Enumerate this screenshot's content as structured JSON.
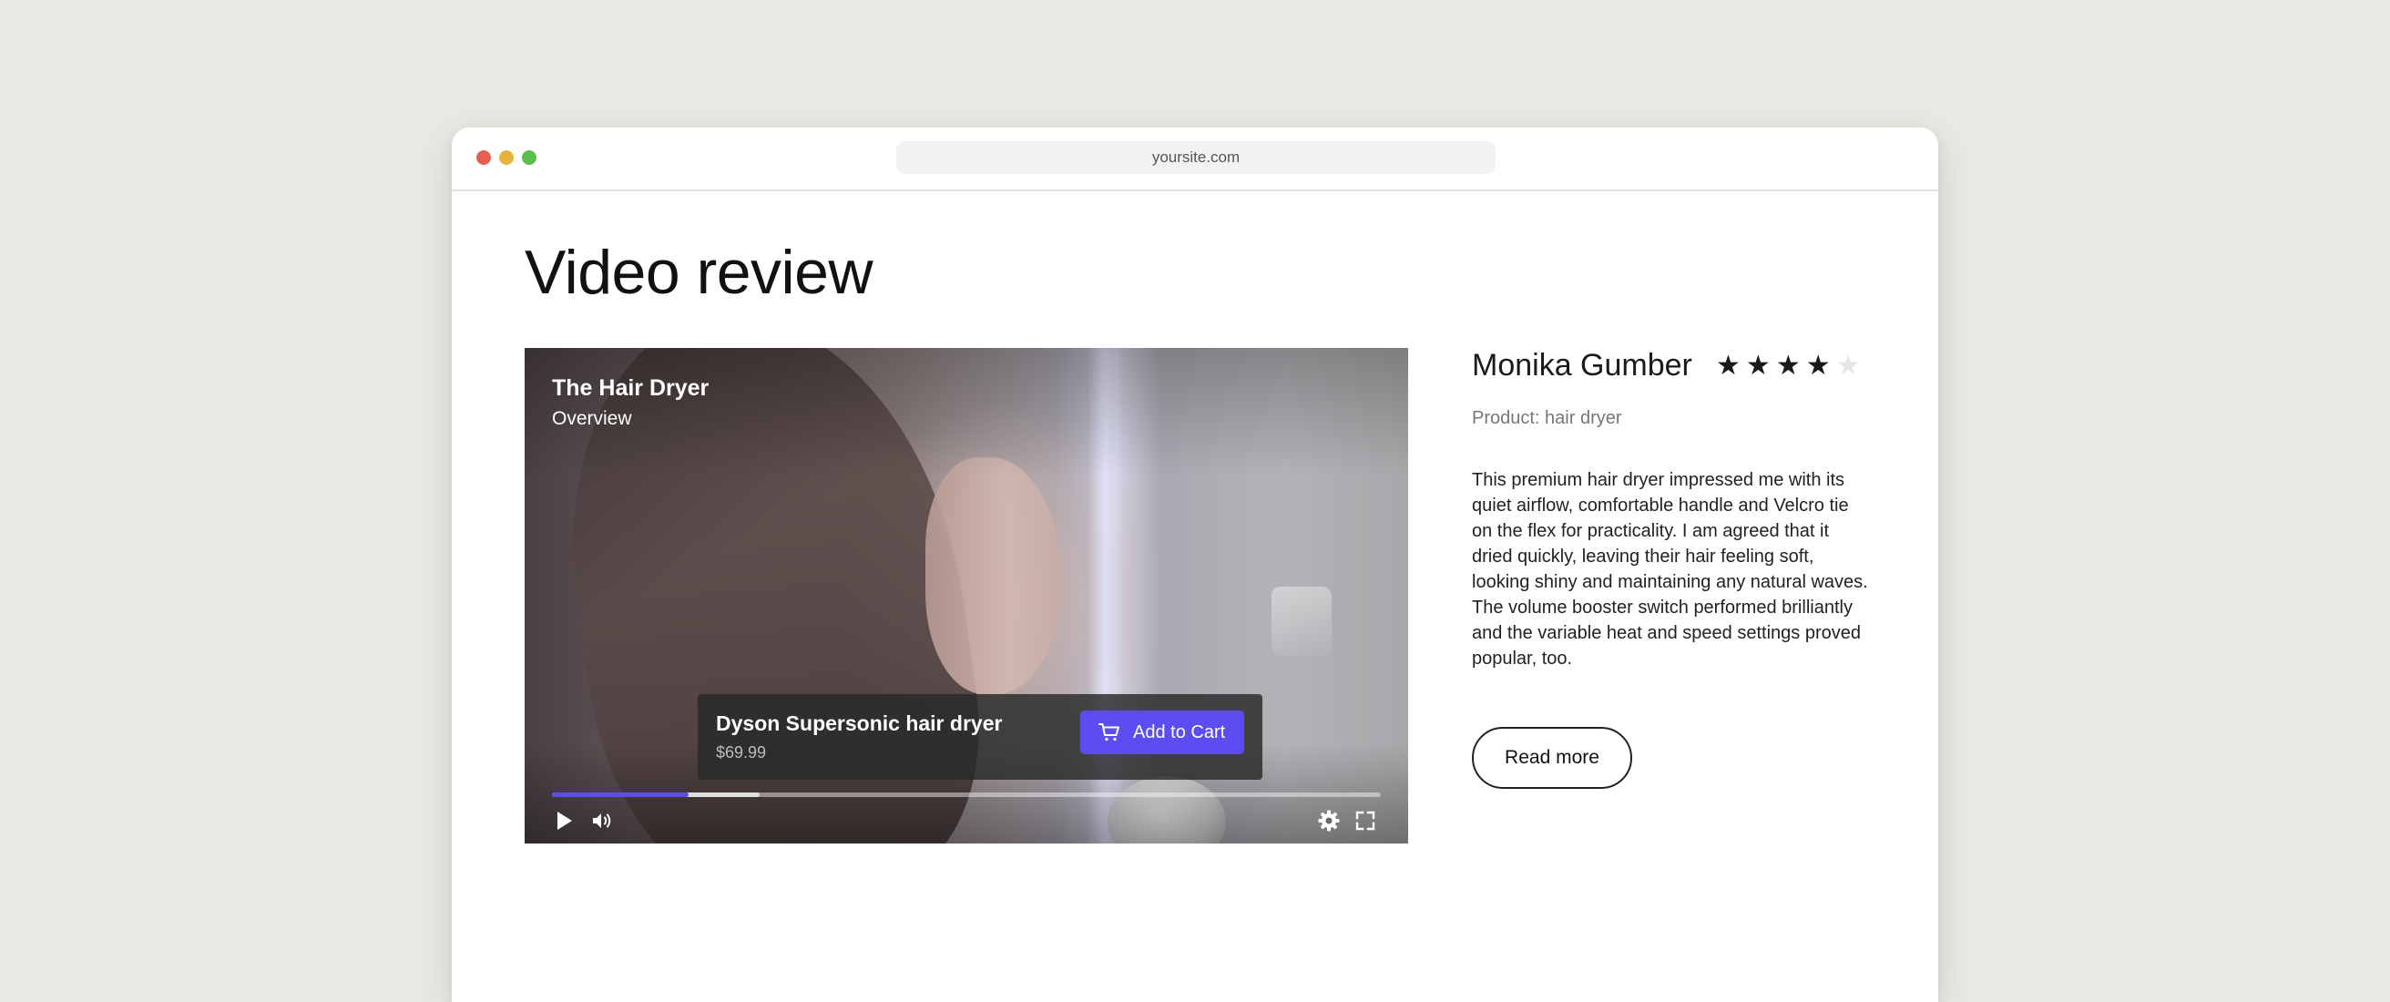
{
  "browser": {
    "url": "yoursite.com"
  },
  "page": {
    "title": "Video review"
  },
  "video": {
    "title": "The Hair Dryer",
    "subtitle": "Overview",
    "progress_percent": 16.5,
    "buffered_percent": 25,
    "controls": {
      "play_icon": "play-icon",
      "volume_icon": "volume-icon",
      "settings_icon": "gear-icon",
      "fullscreen_icon": "fullscreen-icon"
    }
  },
  "product_overlay": {
    "name": "Dyson Supersonic hair dryer",
    "price": "$69.99",
    "cart_button_label": "Add to Cart",
    "cart_icon": "cart-icon",
    "accent_color": "#5b4df0"
  },
  "review": {
    "reviewer_name": "Monika Gumber",
    "rating": 4,
    "rating_max": 5,
    "product_label": "Product: hair dryer",
    "text": "This premium hair dryer impressed me with its quiet airflow, comfortable handle and Velcro tie on the flex for practicality. I am agreed that it dried quickly, leaving their hair feeling soft, looking shiny and maintaining any natural waves. The volume booster switch performed brilliantly and the variable heat and speed settings proved popular, too.",
    "read_more_label": "Read more"
  }
}
